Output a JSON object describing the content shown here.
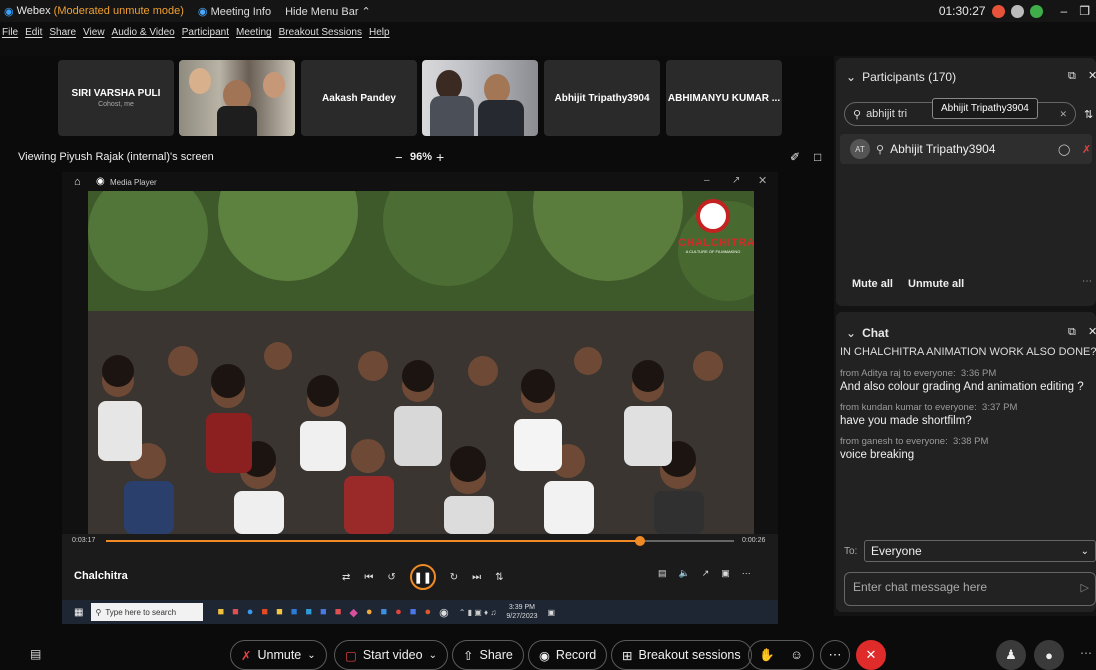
{
  "titlebar": {
    "app": "Webex",
    "mode": "(Moderated unmute mode)",
    "meeting_info": "Meeting Info",
    "hide_menu": "Hide Menu Bar",
    "clock": "01:30:27"
  },
  "menu": [
    "File",
    "Edit",
    "Share",
    "View",
    "Audio & Video",
    "Participant",
    "Meeting",
    "Breakout Sessions",
    "Help"
  ],
  "tiles": {
    "t1_name": "SIRI VARSHA PULI",
    "t1_sub": "Cohost, me",
    "t2_name": "Aakash Pandey",
    "t3_name": "Abhijit Tripathy3904",
    "t4_name": "ABHIMANYU KUMAR ..."
  },
  "share": {
    "viewing": "Viewing Piyush Rajak (internal)'s screen",
    "zoom": "96%",
    "zoom_minus": "−",
    "zoom_plus": "+"
  },
  "player": {
    "window_title": "Media Player",
    "time_elapsed": "0:03:17",
    "time_remaining": "0:00:26",
    "media_title": "Chalchitra",
    "progress": 0.85,
    "logo_text": "CHALCHITRA",
    "logo_tagline": "A CULTURE OF FILMMAKING"
  },
  "taskbar": {
    "search_placeholder": "Type here to search",
    "time": "3:39 PM",
    "date": "9/27/2023"
  },
  "participants": {
    "header": "Participants (170)",
    "search_value": "abhijit tri",
    "tooltip": "Abhijit Tripathy3904",
    "result_name": "Abhijit Tripathy3904",
    "avatar_initials": "AT",
    "mute_all": "Mute all",
    "unmute_all": "Unmute all"
  },
  "chat": {
    "header": "Chat",
    "partial": "IN CHALCHITRA ANIMATION WORK ALSO DONE?",
    "messages": [
      {
        "from": "from Aditya raj to everyone:",
        "time": "3:36 PM",
        "text": "And also colour grading And animation editing ?"
      },
      {
        "from": "from kundan kumar to everyone:",
        "time": "3:37 PM",
        "text": "have you made shortfilm?"
      },
      {
        "from": "from ganesh to everyone:",
        "time": "3:38 PM",
        "text": "voice breaking"
      }
    ],
    "to_label": "To:",
    "to_value": "Everyone",
    "input_placeholder": "Enter chat message here"
  },
  "toolbar": {
    "unmute": "Unmute",
    "start_video": "Start video",
    "share": "Share",
    "record": "Record",
    "breakout": "Breakout sessions"
  },
  "colors": {
    "accent_orange": "#f08a24",
    "end_red": "#e02b2b",
    "panel": "#222222"
  }
}
